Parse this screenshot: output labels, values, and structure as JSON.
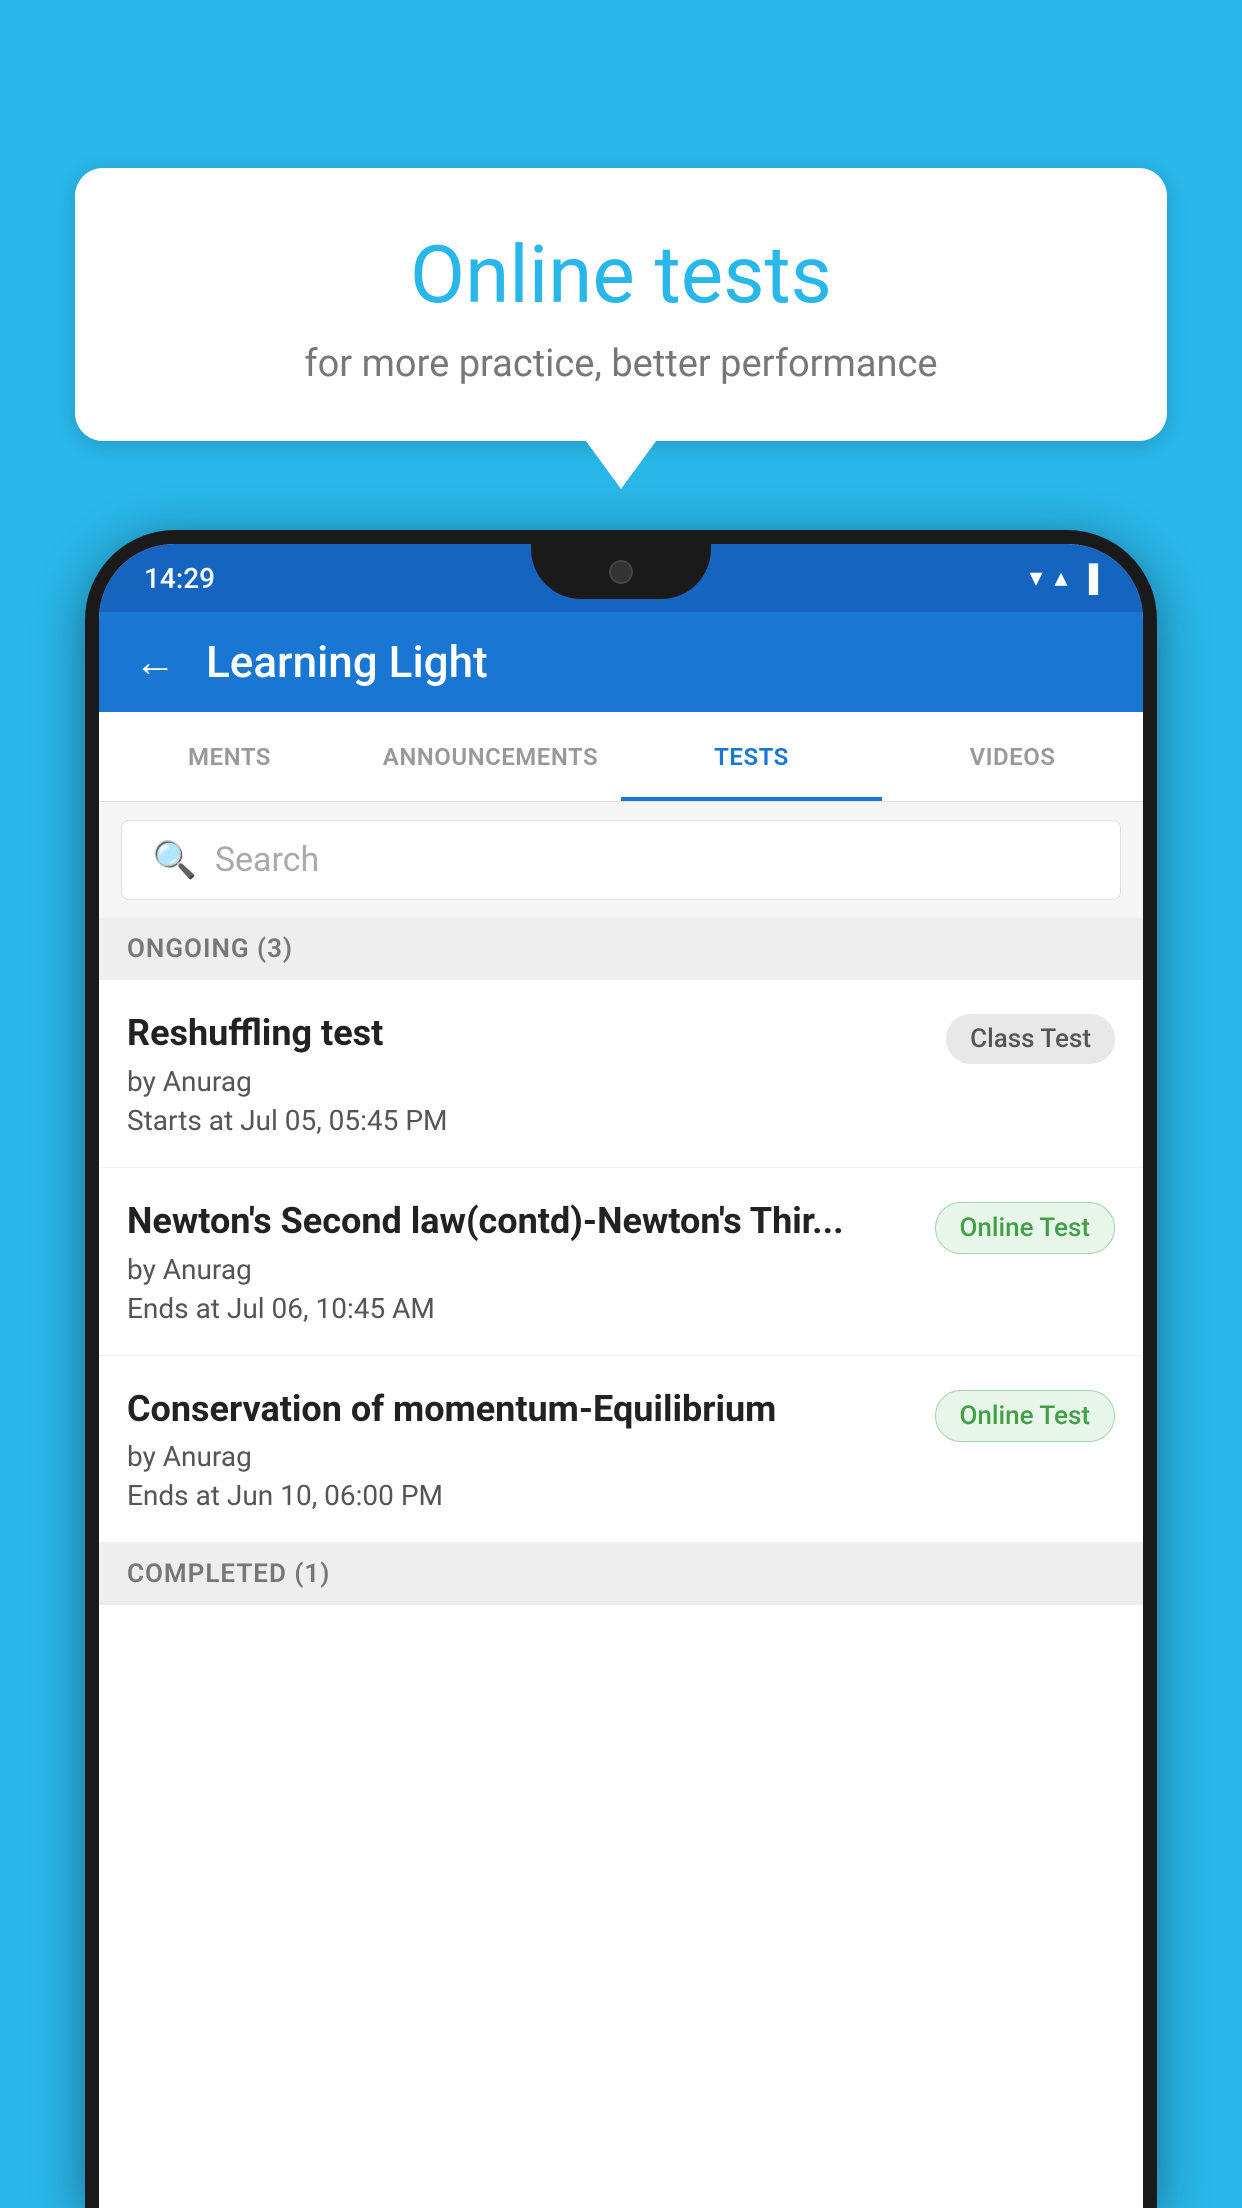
{
  "background_color": "#29b6e8",
  "bubble": {
    "title": "Online tests",
    "subtitle": "for more practice, better performance"
  },
  "status_bar": {
    "time": "14:29",
    "wifi": "▼",
    "signal": "▲",
    "battery": "▐"
  },
  "app_bar": {
    "back_label": "←",
    "title": "Learning Light"
  },
  "tabs": [
    {
      "label": "MENTS",
      "active": false
    },
    {
      "label": "ANNOUNCEMENTS",
      "active": false
    },
    {
      "label": "TESTS",
      "active": true
    },
    {
      "label": "VIDEOS",
      "active": false
    }
  ],
  "search": {
    "placeholder": "Search"
  },
  "ongoing_section": {
    "label": "ONGOING (3)"
  },
  "tests": [
    {
      "name": "Reshuffling test",
      "author": "by Anurag",
      "time_label": "Starts at",
      "time": "Jul 05, 05:45 PM",
      "badge": "Class Test",
      "badge_type": "class"
    },
    {
      "name": "Newton's Second law(contd)-Newton's Thir...",
      "author": "by Anurag",
      "time_label": "Ends at",
      "time": "Jul 06, 10:45 AM",
      "badge": "Online Test",
      "badge_type": "online"
    },
    {
      "name": "Conservation of momentum-Equilibrium",
      "author": "by Anurag",
      "time_label": "Ends at",
      "time": "Jun 10, 06:00 PM",
      "badge": "Online Test",
      "badge_type": "online"
    }
  ],
  "completed_section": {
    "label": "COMPLETED (1)"
  }
}
